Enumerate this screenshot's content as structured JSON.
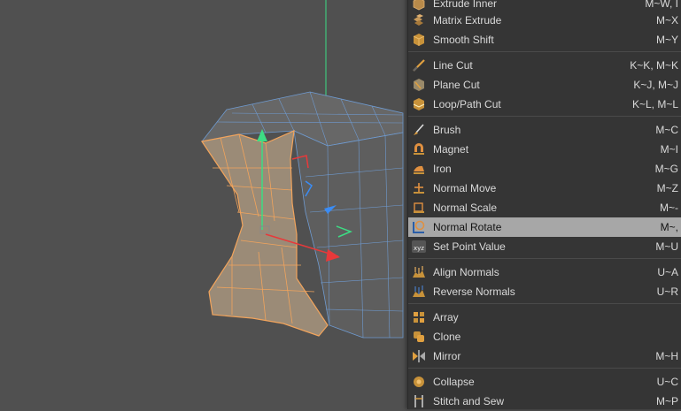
{
  "colors": {
    "viewport_bg": "#505050",
    "menu_bg": "#353535",
    "highlight_bg": "#a7a7a7",
    "menu_text": "#d9d9d9",
    "selection_orange": "#f2a45c",
    "mesh_edge_blue": "#6f9bd1",
    "axis_green": "#3ddc84",
    "axis_red": "#e8393a",
    "axis_blue": "#3a8cf5"
  },
  "menu": {
    "items": [
      {
        "label": "Extrude Inner",
        "shortcut": "M~W, I",
        "icon": "extrude-inner-icon"
      },
      {
        "label": "Matrix Extrude",
        "shortcut": "M~X",
        "icon": "matrix-extrude-icon"
      },
      {
        "label": "Smooth Shift",
        "shortcut": "M~Y",
        "icon": "smooth-shift-icon"
      },
      {
        "label": "Line Cut",
        "shortcut": "K~K, M~K",
        "icon": "line-cut-icon"
      },
      {
        "label": "Plane Cut",
        "shortcut": "K~J, M~J",
        "icon": "plane-cut-icon"
      },
      {
        "label": "Loop/Path Cut",
        "shortcut": "K~L, M~L",
        "icon": "loop-path-cut-icon"
      },
      {
        "label": "Brush",
        "shortcut": "M~C",
        "icon": "brush-icon"
      },
      {
        "label": "Magnet",
        "shortcut": "M~I",
        "icon": "magnet-icon"
      },
      {
        "label": "Iron",
        "shortcut": "M~G",
        "icon": "iron-icon"
      },
      {
        "label": "Normal Move",
        "shortcut": "M~Z",
        "icon": "normal-move-icon"
      },
      {
        "label": "Normal Scale",
        "shortcut": "M~-",
        "icon": "normal-scale-icon"
      },
      {
        "label": "Normal Rotate",
        "shortcut": "M~,",
        "icon": "normal-rotate-icon",
        "highlighted": true
      },
      {
        "label": "Set Point Value",
        "shortcut": "M~U",
        "icon": "set-point-value-icon"
      },
      {
        "label": "Align Normals",
        "shortcut": "U~A",
        "icon": "align-normals-icon"
      },
      {
        "label": "Reverse Normals",
        "shortcut": "U~R",
        "icon": "reverse-normals-icon"
      },
      {
        "label": "Array",
        "shortcut": "",
        "icon": "array-icon"
      },
      {
        "label": "Clone",
        "shortcut": "",
        "icon": "clone-icon"
      },
      {
        "label": "Mirror",
        "shortcut": "M~H",
        "icon": "mirror-icon"
      },
      {
        "label": "Collapse",
        "shortcut": "U~C",
        "icon": "collapse-icon"
      },
      {
        "label": "Stitch and Sew",
        "shortcut": "M~P",
        "icon": "stitch-and-sew-icon"
      }
    ],
    "xyz_badge": "xyz"
  }
}
